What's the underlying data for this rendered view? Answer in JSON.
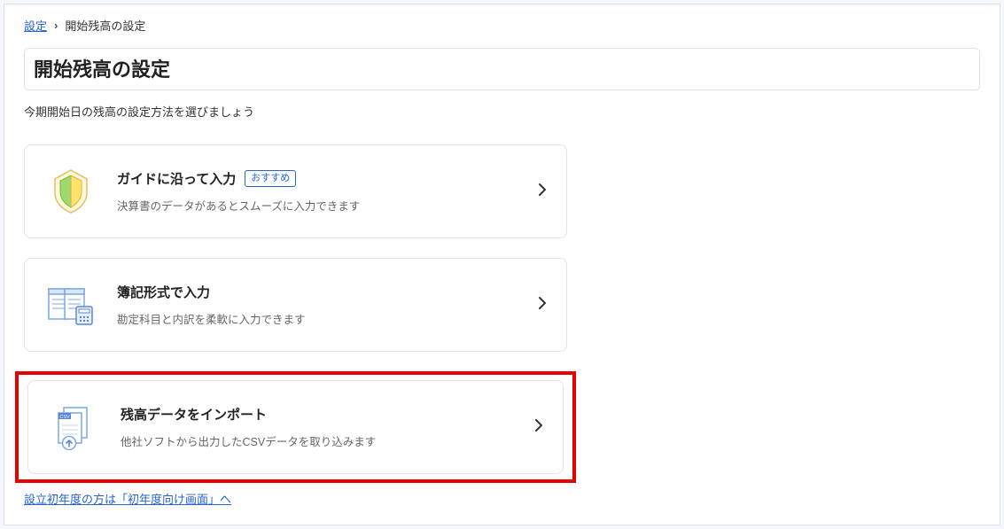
{
  "breadcrumb": {
    "root": "設定",
    "current": "開始残高の設定"
  },
  "page_title": "開始残高の設定",
  "subtitle": "今期開始日の残高の設定方法を選びましょう",
  "cards": [
    {
      "title": "ガイドに沿って入力",
      "badge": "おすすめ",
      "desc": "決算書のデータがあるとスムーズに入力できます"
    },
    {
      "title": "簿記形式で入力",
      "desc": "勘定科目と内訳を柔軟に入力できます"
    },
    {
      "title": "残高データをインポート",
      "desc": "他社ソフトから出力したCSVデータを取り込みます"
    }
  ],
  "footer_link": "設立初年度の方は「初年度向け画面」へ"
}
